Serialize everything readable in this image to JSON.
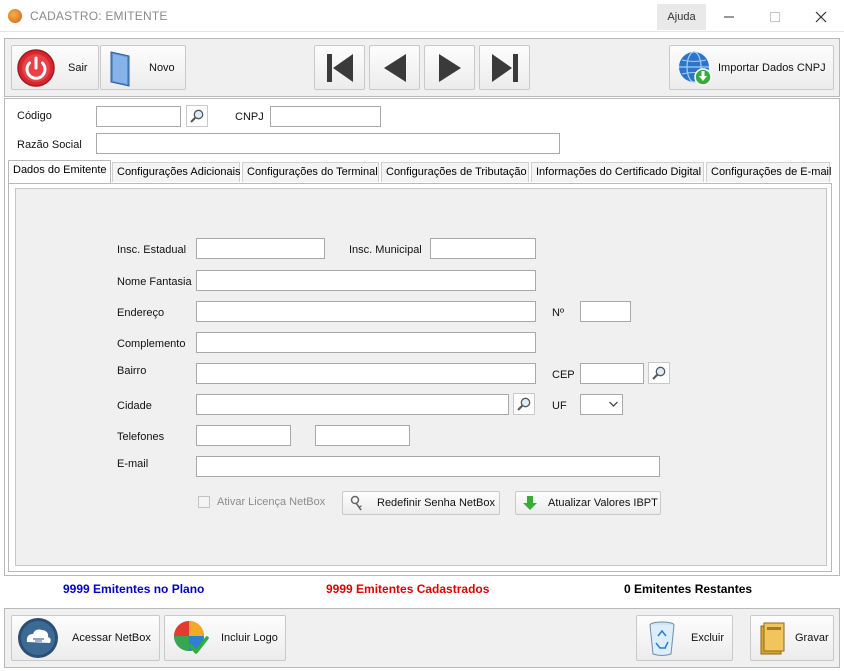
{
  "window": {
    "title": "CADASTRO: EMITENTE",
    "help_label": "Ajuda"
  },
  "toolbar": {
    "exit_label": "Sair",
    "new_label": "Novo",
    "import_label": "Importar Dados CNPJ"
  },
  "header_fields": {
    "code_label": "Código",
    "code_value": "",
    "cnpj_label": "CNPJ",
    "cnpj_value": "",
    "company_label": "Razão Social",
    "company_value": ""
  },
  "tabs": [
    {
      "label": "Dados do Emitente",
      "active": true
    },
    {
      "label": "Configurações Adicionais"
    },
    {
      "label": "Configurações do Terminal"
    },
    {
      "label": "Configurações de Tributação"
    },
    {
      "label": "Informações do Certificado Digital"
    },
    {
      "label": "Configurações de E-mail"
    }
  ],
  "form": {
    "state_reg_label": "Insc. Estadual",
    "state_reg_value": "",
    "city_reg_label": "Insc. Municipal",
    "city_reg_value": "",
    "trade_name_label": "Nome Fantasia",
    "trade_name_value": "",
    "address_label": "Endereço",
    "address_value": "",
    "number_label": "Nº",
    "number_value": "",
    "complement_label": "Complemento",
    "complement_value": "",
    "district_label": "Bairro",
    "district_value": "",
    "zip_label": "CEP",
    "zip_value": "",
    "city_label": "Cidade",
    "city_value": "",
    "state_label": "UF",
    "state_value": "",
    "phones_label": "Telefones",
    "phone1_value": "",
    "phone2_value": "",
    "email_label": "E-mail",
    "email_value": "",
    "license_checkbox_label": "Ativar Licença NetBox",
    "license_checked": false,
    "reset_password_label": "Redefinir Senha NetBox",
    "update_ibpt_label": "Atualizar Valores IBPT"
  },
  "status": {
    "plan": "9999 Emitentes no Plano",
    "registered": "9999 Emitentes Cadastrados",
    "remaining": "0 Emitentes Restantes",
    "plan_color": "#0000cc",
    "registered_color": "#e00000",
    "remaining_color": "#000000"
  },
  "bottom_bar": {
    "access_label": "Acessar NetBox",
    "logo_label": "Incluir Logo",
    "delete_label": "Excluir",
    "save_label": "Gravar"
  }
}
